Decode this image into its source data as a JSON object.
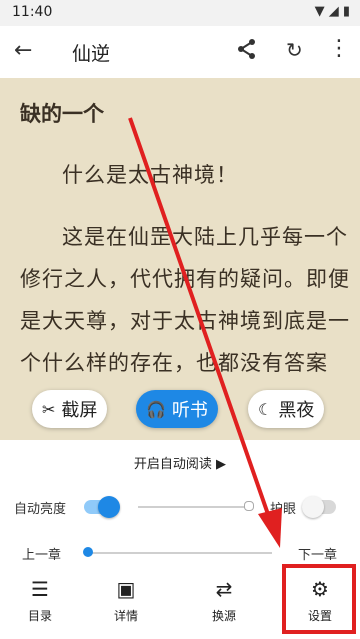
{
  "status": {
    "time": "11:40"
  },
  "appbar": {
    "title": "仙逆"
  },
  "content": {
    "heading": "缺的一个",
    "paragraphs": [
      "什么是太古神境！",
      "这是在仙罡大陆上几乎每一个修行之人，代代拥有的疑问。即便是大天尊，对于太古神境到底是一个什么样的存在，也都没有答案"
    ]
  },
  "fabs": {
    "screenshot": "截屏",
    "listen": "听书",
    "night": "黑夜"
  },
  "panel": {
    "auto_read": "开启自动阅读 ▶",
    "auto_brightness": "自动亮度",
    "eye_protect": "护眼",
    "prev_chapter": "上一章",
    "next_chapter": "下一章"
  },
  "nav": {
    "catalog": "目录",
    "details": "详情",
    "switch_source": "换源",
    "settings": "设置"
  },
  "colors": {
    "accent": "#1e88e5",
    "annotation": "#e02020"
  }
}
